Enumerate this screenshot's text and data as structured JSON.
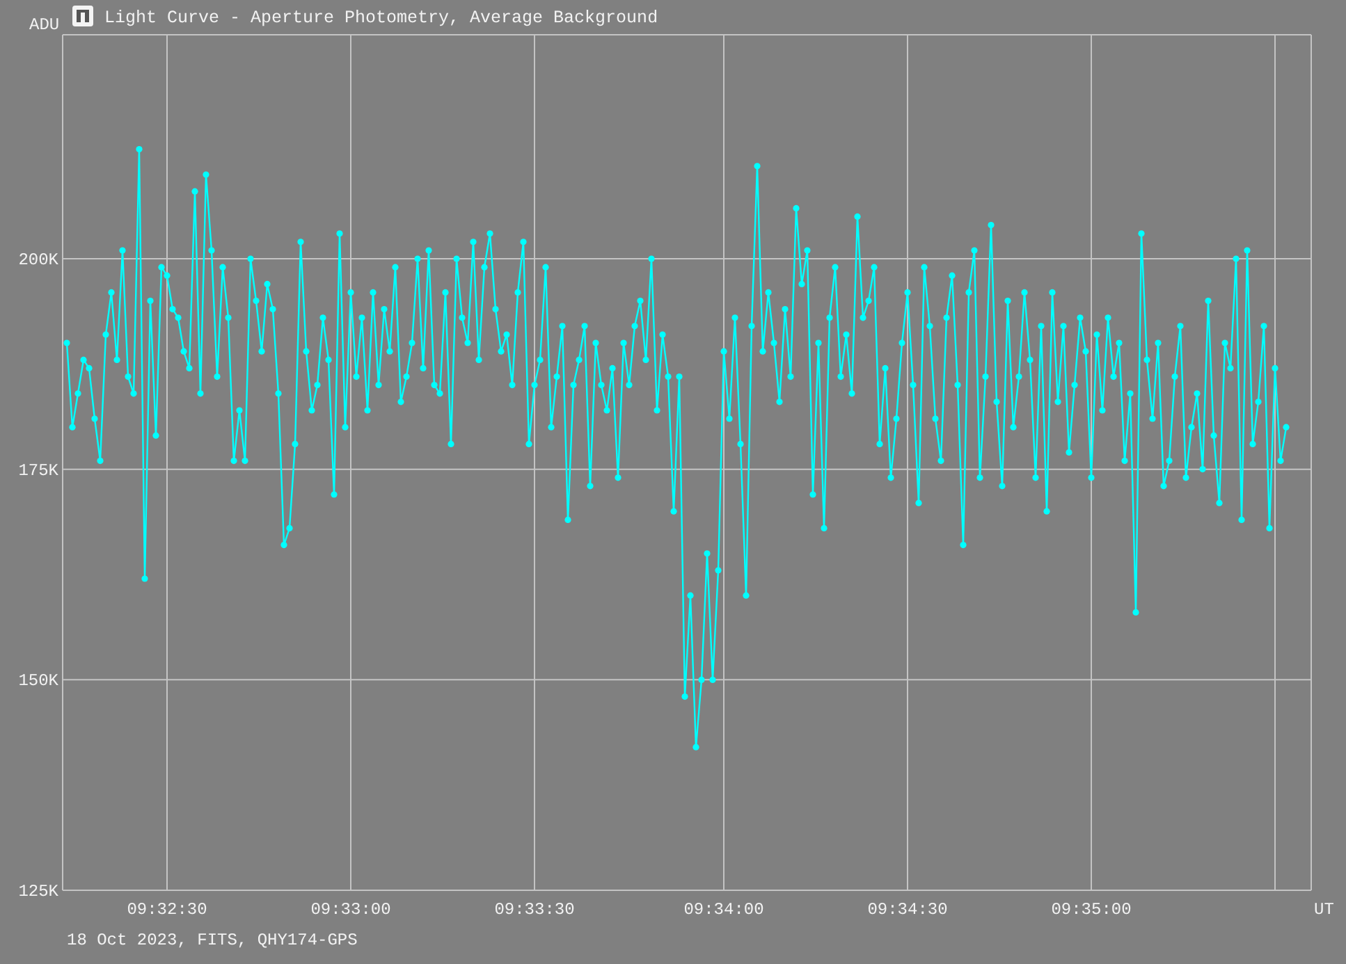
{
  "window": {
    "title": "Light Curve - Aperture Photometry, Average Background"
  },
  "footer": "18 Oct 2023, FITS, QHY174-GPS",
  "chart_data": {
    "type": "line",
    "xlabel": "UT",
    "ylabel": "ADU",
    "ylim": [
      125,
      226.6
    ],
    "grid": true,
    "yticks": [
      {
        "value": 125,
        "label": "125K"
      },
      {
        "value": 150,
        "label": "150K"
      },
      {
        "value": 175,
        "label": "175K"
      },
      {
        "value": 200,
        "label": "200K"
      }
    ],
    "categories": [
      null,
      null,
      null,
      null,
      null,
      null,
      null,
      null,
      null,
      null,
      null,
      null,
      null,
      null,
      null,
      null,
      null,
      null,
      "09:32:30",
      null,
      null,
      null,
      null,
      null,
      null,
      null,
      null,
      null,
      null,
      null,
      null,
      null,
      null,
      null,
      null,
      null,
      null,
      null,
      null,
      null,
      null,
      null,
      null,
      null,
      null,
      null,
      null,
      null,
      null,
      null,
      null,
      "09:33:00",
      null,
      null,
      null,
      null,
      null,
      null,
      null,
      null,
      null,
      null,
      null,
      null,
      null,
      null,
      null,
      null,
      null,
      null,
      null,
      null,
      null,
      null,
      null,
      null,
      null,
      null,
      null,
      null,
      null,
      null,
      null,
      null,
      "09:33:30",
      null,
      null,
      null,
      null,
      null,
      null,
      null,
      null,
      null,
      null,
      null,
      null,
      null,
      null,
      null,
      null,
      null,
      null,
      null,
      null,
      null,
      null,
      null,
      null,
      null,
      null,
      null,
      null,
      null,
      null,
      null,
      null,
      null,
      "09:34:00",
      null,
      null,
      null,
      null,
      null,
      null,
      null,
      null,
      null,
      null,
      null,
      null,
      null,
      null,
      null,
      null,
      null,
      null,
      null,
      null,
      null,
      null,
      null,
      null,
      null,
      null,
      null,
      null,
      null,
      null,
      null,
      null,
      "09:34:30",
      null,
      null,
      null,
      null,
      null,
      null,
      null,
      null,
      null,
      null,
      null,
      null,
      null,
      null,
      null,
      null,
      null,
      null,
      null,
      null,
      null,
      null,
      null,
      null,
      null,
      null,
      null,
      null,
      null,
      null,
      null,
      null,
      "09:35:00",
      null,
      null,
      null,
      null,
      null,
      null,
      null,
      null,
      null,
      null,
      null,
      null,
      null,
      null,
      null,
      null,
      null,
      null,
      null,
      null,
      null,
      null,
      null,
      null,
      null,
      null,
      null,
      null,
      null,
      null,
      null,
      null,
      null,
      null,
      null
    ],
    "series": [
      {
        "color": "#00ffff",
        "values": [
          190,
          180,
          184,
          188,
          187,
          181,
          176,
          191,
          196,
          188,
          201,
          186,
          184,
          213,
          162,
          195,
          179,
          199,
          198,
          194,
          193,
          189,
          187,
          208,
          184,
          210,
          201,
          186,
          199,
          193,
          176,
          182,
          176,
          200,
          195,
          189,
          197,
          194,
          184,
          166,
          168,
          178,
          202,
          189,
          182,
          185,
          193,
          188,
          172,
          203,
          180,
          196,
          186,
          193,
          182,
          196,
          185,
          194,
          189,
          199,
          183,
          186,
          190,
          200,
          187,
          201,
          185,
          184,
          196,
          178,
          200,
          193,
          190,
          202,
          188,
          199,
          203,
          194,
          189,
          191,
          185,
          196,
          202,
          178,
          185,
          188,
          199,
          180,
          186,
          192,
          169,
          185,
          188,
          192,
          173,
          190,
          185,
          182,
          187,
          174,
          190,
          185,
          192,
          195,
          188,
          200,
          182,
          191,
          186,
          170,
          186,
          148,
          160,
          142,
          150,
          165,
          150,
          163,
          189,
          181,
          193,
          178,
          160,
          192,
          211,
          189,
          196,
          190,
          183,
          194,
          186,
          206,
          197,
          201,
          172,
          190,
          168,
          193,
          199,
          186,
          191,
          184,
          205,
          193,
          195,
          199,
          178,
          187,
          174,
          181,
          190,
          196,
          185,
          171,
          199,
          192,
          181,
          176,
          193,
          198,
          185,
          166,
          196,
          201,
          174,
          186,
          204,
          183,
          173,
          195,
          180,
          186,
          196,
          188,
          174,
          192,
          170,
          196,
          183,
          192,
          177,
          185,
          193,
          189,
          174,
          191,
          182,
          193,
          186,
          190,
          176,
          184,
          158,
          203,
          188,
          181,
          190,
          173,
          176,
          186,
          192,
          174,
          180,
          184,
          175,
          195,
          179,
          171,
          190,
          187,
          200,
          169,
          201,
          178,
          183,
          192,
          168,
          187,
          176,
          180
        ]
      }
    ]
  }
}
